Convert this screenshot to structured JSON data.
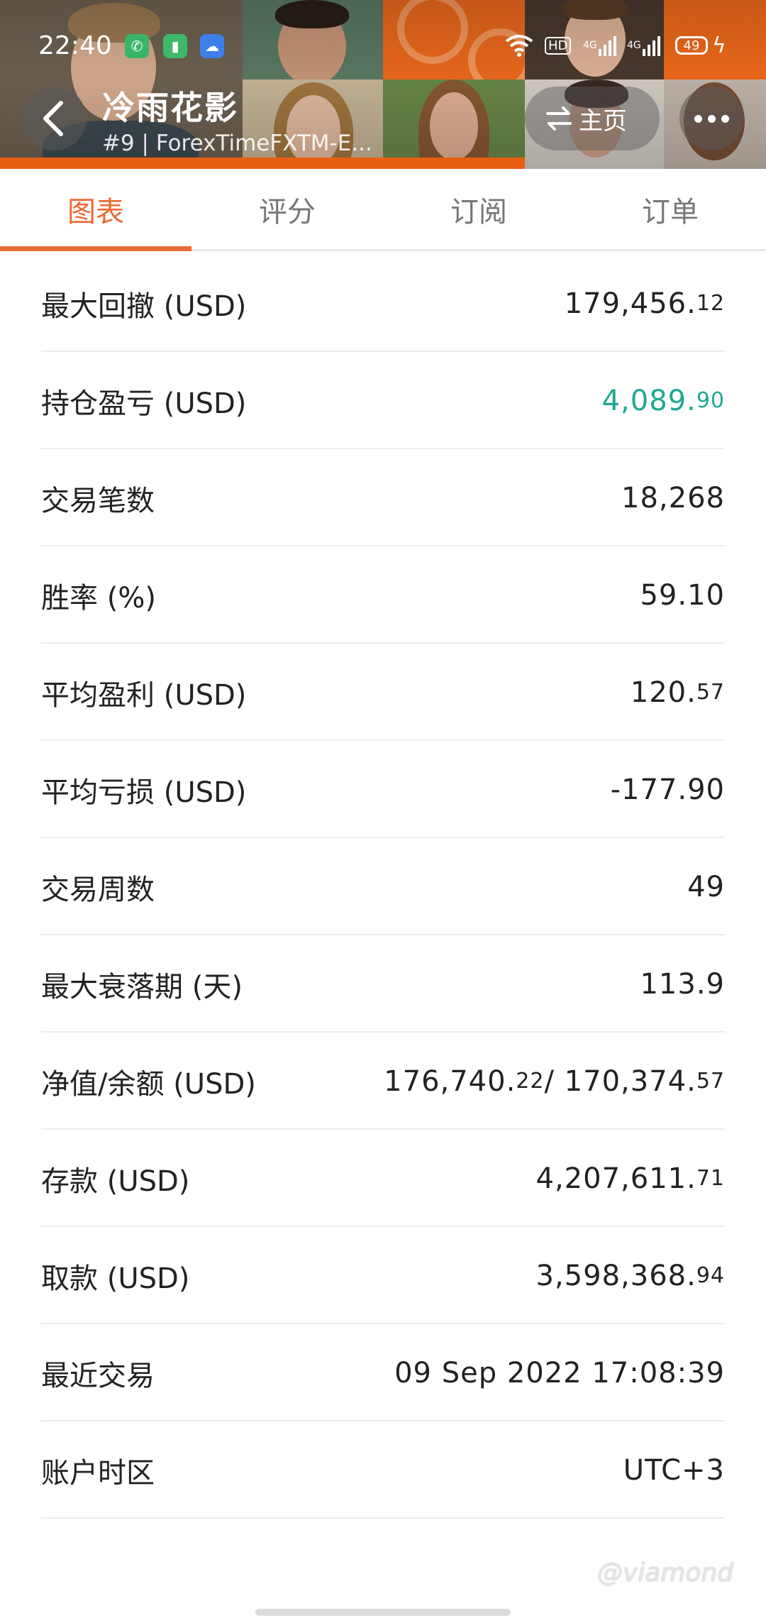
{
  "status_bar": {
    "time": "22:40",
    "network": "4G",
    "network2": "4G",
    "hd": "HD",
    "battery": "49"
  },
  "header": {
    "title": "冷雨花影",
    "subtitle": "#9 | ForexTimeFXTM-E...",
    "home_label": "主页",
    "accent": "#ec6a35"
  },
  "tabs": [
    "图表",
    "评分",
    "订阅",
    "订单"
  ],
  "stats": [
    {
      "label": "最大回撤 (USD)",
      "value_main": "179,456.",
      "value_small": "12"
    },
    {
      "label": "持仓盈亏 (USD)",
      "value_main": "4,089.",
      "value_small": "90",
      "color": "#1fa890"
    },
    {
      "label": "交易笔数",
      "value_main": "18,268"
    },
    {
      "label": "胜率 (%)",
      "value_main": "59.10"
    },
    {
      "label": "平均盈利 (USD)",
      "value_main": "120.",
      "value_small": "57"
    },
    {
      "label": "平均亏损 (USD)",
      "value_main": "-177.90"
    },
    {
      "label": "交易周数",
      "value_main": "49"
    },
    {
      "label": "最大衰落期 (天)",
      "value_main": "113.9"
    },
    {
      "label": "净值/余额 (USD)",
      "value_main": "176,740.",
      "value_small": "22",
      "value_main2": " / 170,374.",
      "value_small2": "57"
    },
    {
      "label": "存款 (USD)",
      "value_main": "4,207,611.",
      "value_small": "71"
    },
    {
      "label": "取款 (USD)",
      "value_main": "3,598,368.",
      "value_small": "94"
    },
    {
      "label": "最近交易",
      "value_main": "09 Sep 2022 17:08:39"
    },
    {
      "label": "账户时区",
      "value_main": "UTC+3"
    }
  ],
  "watermark": "@viamond"
}
